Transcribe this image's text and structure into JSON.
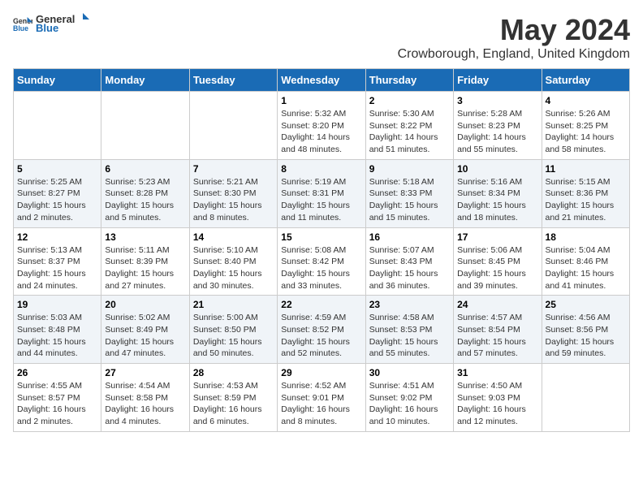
{
  "header": {
    "logo_general": "General",
    "logo_blue": "Blue",
    "title": "May 2024",
    "subtitle": "Crowborough, England, United Kingdom"
  },
  "weekdays": [
    "Sunday",
    "Monday",
    "Tuesday",
    "Wednesday",
    "Thursday",
    "Friday",
    "Saturday"
  ],
  "weeks": [
    [
      {
        "day": "",
        "info": ""
      },
      {
        "day": "",
        "info": ""
      },
      {
        "day": "",
        "info": ""
      },
      {
        "day": "1",
        "info": "Sunrise: 5:32 AM\nSunset: 8:20 PM\nDaylight: 14 hours\nand 48 minutes."
      },
      {
        "day": "2",
        "info": "Sunrise: 5:30 AM\nSunset: 8:22 PM\nDaylight: 14 hours\nand 51 minutes."
      },
      {
        "day": "3",
        "info": "Sunrise: 5:28 AM\nSunset: 8:23 PM\nDaylight: 14 hours\nand 55 minutes."
      },
      {
        "day": "4",
        "info": "Sunrise: 5:26 AM\nSunset: 8:25 PM\nDaylight: 14 hours\nand 58 minutes."
      }
    ],
    [
      {
        "day": "5",
        "info": "Sunrise: 5:25 AM\nSunset: 8:27 PM\nDaylight: 15 hours\nand 2 minutes."
      },
      {
        "day": "6",
        "info": "Sunrise: 5:23 AM\nSunset: 8:28 PM\nDaylight: 15 hours\nand 5 minutes."
      },
      {
        "day": "7",
        "info": "Sunrise: 5:21 AM\nSunset: 8:30 PM\nDaylight: 15 hours\nand 8 minutes."
      },
      {
        "day": "8",
        "info": "Sunrise: 5:19 AM\nSunset: 8:31 PM\nDaylight: 15 hours\nand 11 minutes."
      },
      {
        "day": "9",
        "info": "Sunrise: 5:18 AM\nSunset: 8:33 PM\nDaylight: 15 hours\nand 15 minutes."
      },
      {
        "day": "10",
        "info": "Sunrise: 5:16 AM\nSunset: 8:34 PM\nDaylight: 15 hours\nand 18 minutes."
      },
      {
        "day": "11",
        "info": "Sunrise: 5:15 AM\nSunset: 8:36 PM\nDaylight: 15 hours\nand 21 minutes."
      }
    ],
    [
      {
        "day": "12",
        "info": "Sunrise: 5:13 AM\nSunset: 8:37 PM\nDaylight: 15 hours\nand 24 minutes."
      },
      {
        "day": "13",
        "info": "Sunrise: 5:11 AM\nSunset: 8:39 PM\nDaylight: 15 hours\nand 27 minutes."
      },
      {
        "day": "14",
        "info": "Sunrise: 5:10 AM\nSunset: 8:40 PM\nDaylight: 15 hours\nand 30 minutes."
      },
      {
        "day": "15",
        "info": "Sunrise: 5:08 AM\nSunset: 8:42 PM\nDaylight: 15 hours\nand 33 minutes."
      },
      {
        "day": "16",
        "info": "Sunrise: 5:07 AM\nSunset: 8:43 PM\nDaylight: 15 hours\nand 36 minutes."
      },
      {
        "day": "17",
        "info": "Sunrise: 5:06 AM\nSunset: 8:45 PM\nDaylight: 15 hours\nand 39 minutes."
      },
      {
        "day": "18",
        "info": "Sunrise: 5:04 AM\nSunset: 8:46 PM\nDaylight: 15 hours\nand 41 minutes."
      }
    ],
    [
      {
        "day": "19",
        "info": "Sunrise: 5:03 AM\nSunset: 8:48 PM\nDaylight: 15 hours\nand 44 minutes."
      },
      {
        "day": "20",
        "info": "Sunrise: 5:02 AM\nSunset: 8:49 PM\nDaylight: 15 hours\nand 47 minutes."
      },
      {
        "day": "21",
        "info": "Sunrise: 5:00 AM\nSunset: 8:50 PM\nDaylight: 15 hours\nand 50 minutes."
      },
      {
        "day": "22",
        "info": "Sunrise: 4:59 AM\nSunset: 8:52 PM\nDaylight: 15 hours\nand 52 minutes."
      },
      {
        "day": "23",
        "info": "Sunrise: 4:58 AM\nSunset: 8:53 PM\nDaylight: 15 hours\nand 55 minutes."
      },
      {
        "day": "24",
        "info": "Sunrise: 4:57 AM\nSunset: 8:54 PM\nDaylight: 15 hours\nand 57 minutes."
      },
      {
        "day": "25",
        "info": "Sunrise: 4:56 AM\nSunset: 8:56 PM\nDaylight: 15 hours\nand 59 minutes."
      }
    ],
    [
      {
        "day": "26",
        "info": "Sunrise: 4:55 AM\nSunset: 8:57 PM\nDaylight: 16 hours\nand 2 minutes."
      },
      {
        "day": "27",
        "info": "Sunrise: 4:54 AM\nSunset: 8:58 PM\nDaylight: 16 hours\nand 4 minutes."
      },
      {
        "day": "28",
        "info": "Sunrise: 4:53 AM\nSunset: 8:59 PM\nDaylight: 16 hours\nand 6 minutes."
      },
      {
        "day": "29",
        "info": "Sunrise: 4:52 AM\nSunset: 9:01 PM\nDaylight: 16 hours\nand 8 minutes."
      },
      {
        "day": "30",
        "info": "Sunrise: 4:51 AM\nSunset: 9:02 PM\nDaylight: 16 hours\nand 10 minutes."
      },
      {
        "day": "31",
        "info": "Sunrise: 4:50 AM\nSunset: 9:03 PM\nDaylight: 16 hours\nand 12 minutes."
      },
      {
        "day": "",
        "info": ""
      }
    ]
  ]
}
